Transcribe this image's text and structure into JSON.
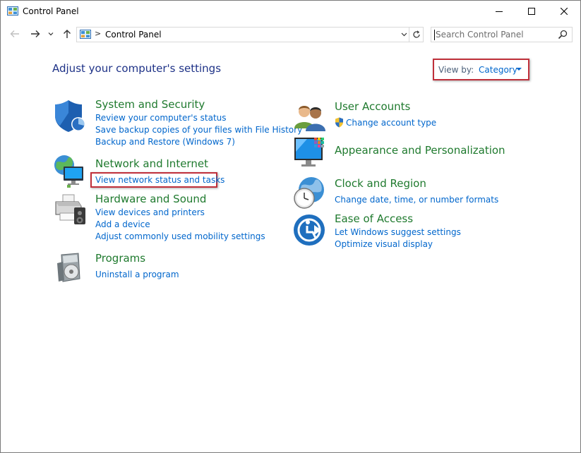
{
  "window": {
    "title": "Control Panel",
    "icon": "control-panel-icon",
    "buttons": [
      "minimize-icon",
      "maximize-icon",
      "close-icon"
    ]
  },
  "navigation": {
    "back_icon": "arrow-left-icon",
    "forward_icon": "arrow-right-icon",
    "recent_icon": "chevron-down-icon",
    "up_icon": "arrow-up-icon",
    "breadcrumb_separator": ">",
    "address": "Control Panel",
    "refresh_icon": "refresh-icon"
  },
  "search": {
    "placeholder": "Search Control Panel",
    "icon": "search-icon"
  },
  "main": {
    "heading": "Adjust your computer's settings",
    "view_by": {
      "label": "View by:",
      "value": "Category"
    },
    "categories": [
      {
        "title": "System and Security",
        "icon": "shield-icon",
        "links": [
          "Review your computer's status",
          "Save backup copies of your files with File History",
          "Backup and Restore (Windows 7)"
        ]
      },
      {
        "title": "Network and Internet",
        "icon": "network-icon",
        "links": [
          "View network status and tasks"
        ]
      },
      {
        "title": "Hardware and Sound",
        "icon": "printer-icon",
        "links": [
          "View devices and printers",
          "Add a device",
          "Adjust commonly used mobility settings"
        ]
      },
      {
        "title": "Programs",
        "icon": "programs-icon",
        "links": [
          "Uninstall a program"
        ]
      },
      {
        "title": "User Accounts",
        "icon": "users-icon",
        "links": [
          "Change account type"
        ]
      },
      {
        "title": "Appearance and Personalization",
        "icon": "monitor-icon",
        "links": []
      },
      {
        "title": "Clock and Region",
        "icon": "clock-icon",
        "links": [
          "Change date, time, or number formats"
        ]
      },
      {
        "title": "Ease of Access",
        "icon": "accessibility-icon",
        "links": [
          "Let Windows suggest settings",
          "Optimize visual display"
        ]
      }
    ]
  },
  "colors": {
    "heading": "#1e3287",
    "category_title": "#1f7a2e",
    "link": "#0066cc",
    "highlight_border": "#c0303b"
  }
}
